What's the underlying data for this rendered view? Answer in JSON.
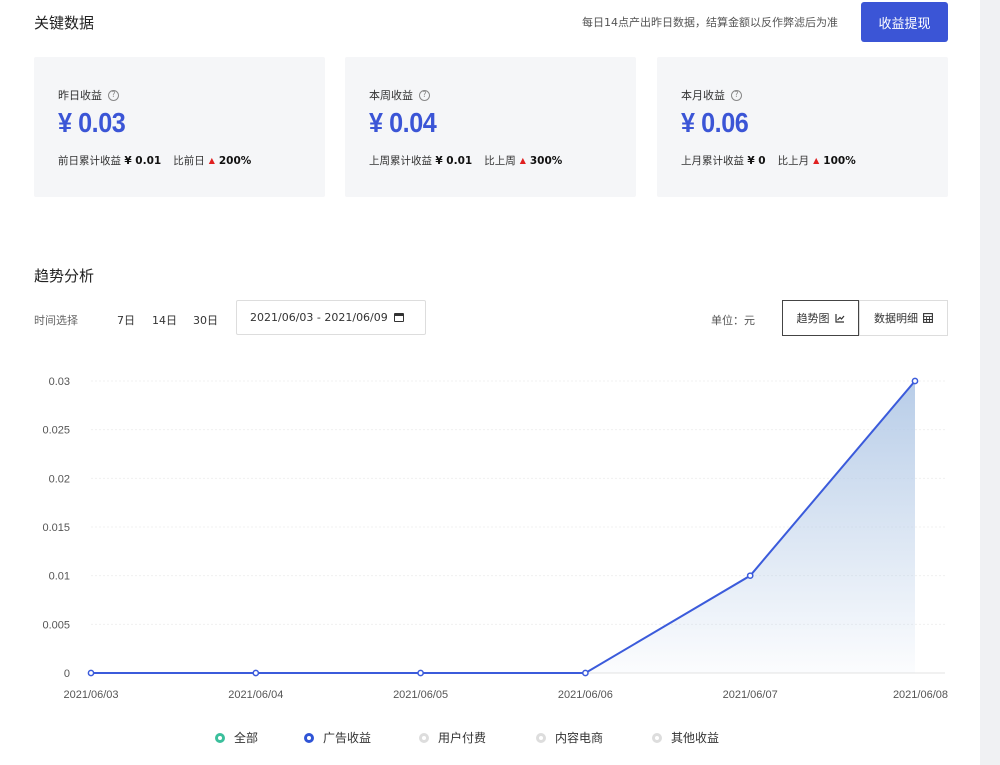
{
  "header": {
    "title": "关键数据",
    "note": "每日14点产出昨日数据，结算金额以反作弊滤后为准",
    "withdraw_label": "收益提现"
  },
  "cards": [
    {
      "label": "昨日收益",
      "value": "¥ 0.03",
      "prev_label": "前日累计收益",
      "prev_value": "¥ 0.01",
      "cmp_label": "比前日",
      "cmp_value": "200%"
    },
    {
      "label": "本周收益",
      "value": "¥ 0.04",
      "prev_label": "上周累计收益",
      "prev_value": "¥ 0.01",
      "cmp_label": "比上周",
      "cmp_value": "300%"
    },
    {
      "label": "本月收益",
      "value": "¥ 0.06",
      "prev_label": "上月累计收益",
      "prev_value": "¥ 0",
      "cmp_label": "比上月",
      "cmp_value": "100%"
    }
  ],
  "trend": {
    "title": "趋势分析",
    "filter_label": "时间选择",
    "ranges": [
      "7日",
      "14日",
      "30日"
    ],
    "date_range": "2021/06/03 - 2021/06/09",
    "unit": "单位：元",
    "view_chart": "趋势图",
    "view_table": "数据明细"
  },
  "chart_data": {
    "type": "area",
    "categories": [
      "2021/06/03",
      "2021/06/04",
      "2021/06/05",
      "2021/06/06",
      "2021/06/07",
      "2021/06/08"
    ],
    "series": [
      {
        "name": "广告收益",
        "values": [
          0,
          0,
          0,
          0,
          0.01,
          0.03
        ]
      }
    ],
    "yticks": [
      "0",
      "0.005",
      "0.01",
      "0.015",
      "0.02",
      "0.025",
      "0.03"
    ],
    "ylim": [
      0,
      0.03
    ],
    "grid": true,
    "line_color": "#3b5bdb",
    "fill_color": "#b8cde8"
  },
  "legend": [
    {
      "label": "全部",
      "color": "#3bbf9c",
      "active": true
    },
    {
      "label": "广告收益",
      "color": "#2f54d6",
      "active": true
    },
    {
      "label": "用户付费",
      "color": "#dddddd",
      "active": false
    },
    {
      "label": "内容电商",
      "color": "#dddddd",
      "active": false
    },
    {
      "label": "其他收益",
      "color": "#dddddd",
      "active": false
    }
  ]
}
